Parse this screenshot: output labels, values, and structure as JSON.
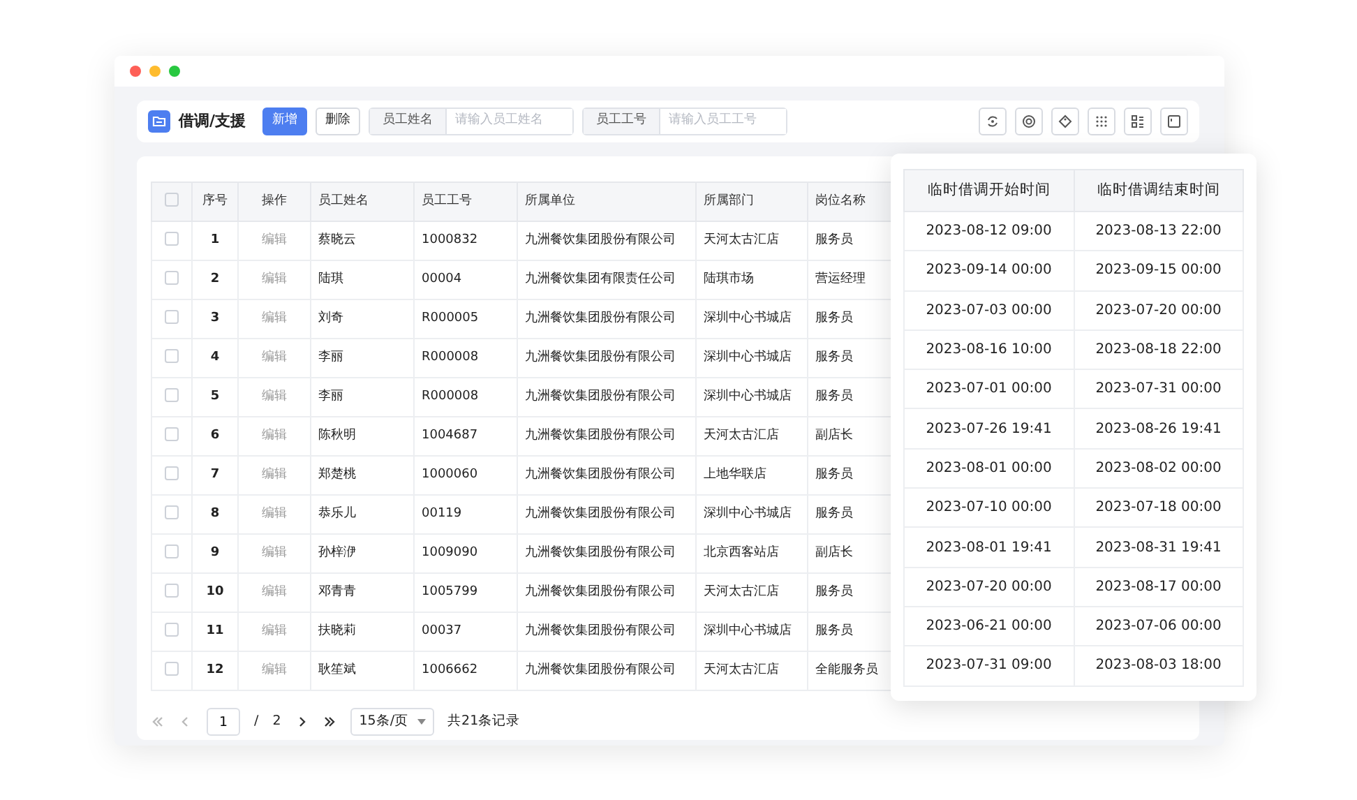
{
  "header": {
    "title": "借调/支援",
    "buttons": [
      {
        "label": "新增",
        "kind": "primary"
      },
      {
        "label": "删除",
        "kind": "default"
      }
    ],
    "filters": [
      {
        "label": "员工姓名",
        "placeholder": "请输入员工姓名"
      },
      {
        "label": "员工工号",
        "placeholder": "请输入员工工号"
      }
    ]
  },
  "table": {
    "columns": [
      "序号",
      "操作",
      "员工姓名",
      "员工工号",
      "所属单位",
      "所属部门",
      "岗位名称"
    ],
    "header_checked": false,
    "rows": [
      {
        "checked": false,
        "cells": [
          "1",
          "编辑",
          "蔡晓云",
          "1000832",
          "九洲餐饮集团股份有限公司",
          "天河太古汇店",
          "服务员"
        ]
      },
      {
        "checked": false,
        "cells": [
          "2",
          "编辑",
          "陆琪",
          "00004",
          "九洲餐饮集团有限责任公司",
          "陆琪市场",
          "营运经理"
        ]
      },
      {
        "checked": false,
        "cells": [
          "3",
          "编辑",
          "刘奇",
          "R000005",
          "九洲餐饮集团股份有限公司",
          "深圳中心书城店",
          "服务员"
        ]
      },
      {
        "checked": false,
        "cells": [
          "4",
          "编辑",
          "李丽",
          "R000008",
          "九洲餐饮集团股份有限公司",
          "深圳中心书城店",
          "服务员"
        ]
      },
      {
        "checked": false,
        "cells": [
          "5",
          "编辑",
          "李丽",
          "R000008",
          "九洲餐饮集团股份有限公司",
          "深圳中心书城店",
          "服务员"
        ]
      },
      {
        "checked": false,
        "cells": [
          "6",
          "编辑",
          "陈秋明",
          "1004687",
          "九洲餐饮集团股份有限公司",
          "天河太古汇店",
          "副店长"
        ]
      },
      {
        "checked": false,
        "cells": [
          "7",
          "编辑",
          "郑楚桃",
          "1000060",
          "九洲餐饮集团股份有限公司",
          "上地华联店",
          "服务员"
        ]
      },
      {
        "checked": false,
        "cells": [
          "8",
          "编辑",
          "恭乐儿",
          "00119",
          "九洲餐饮集团股份有限公司",
          "深圳中心书城店",
          "服务员"
        ]
      },
      {
        "checked": false,
        "cells": [
          "9",
          "编辑",
          "孙梓洢",
          "1009090",
          "九洲餐饮集团股份有限公司",
          "北京西客站店",
          "副店长"
        ]
      },
      {
        "checked": false,
        "cells": [
          "10",
          "编辑",
          "邓青青",
          "1005799",
          "九洲餐饮集团股份有限公司",
          "天河太古汇店",
          "服务员"
        ]
      },
      {
        "checked": false,
        "cells": [
          "11",
          "编辑",
          "扶晓莉",
          "00037",
          "九洲餐饮集团股份有限公司",
          "深圳中心书城店",
          "服务员"
        ]
      },
      {
        "checked": false,
        "cells": [
          "12",
          "编辑",
          "耿笙斌",
          "1006662",
          "九洲餐饮集团股份有限公司",
          "天河太古汇店",
          "全能服务员"
        ]
      }
    ]
  },
  "pagination": {
    "first_disabled": true,
    "prev_disabled": true,
    "page": "1",
    "separator": "/",
    "total_pages": "2",
    "page_size": "15条/页",
    "summary": "共21条记录"
  },
  "popup_table": {
    "columns": [
      "临时借调开始时间",
      "临时借调结束时间"
    ],
    "rows": [
      [
        "2023-08-12 09:00",
        "2023-08-13 22:00"
      ],
      [
        "2023-09-14 00:00",
        "2023-09-15 00:00"
      ],
      [
        "2023-07-03 00:00",
        "2023-07-20 00:00"
      ],
      [
        "2023-08-16 10:00",
        "2023-08-18 22:00"
      ],
      [
        "2023-07-01 00:00",
        "2023-07-31 00:00"
      ],
      [
        "2023-07-26 19:41",
        "2023-08-26 19:41"
      ],
      [
        "2023-08-01 00:00",
        "2023-08-02 00:00"
      ],
      [
        "2023-07-10 00:00",
        "2023-07-18 00:00"
      ],
      [
        "2023-08-01 19:41",
        "2023-08-31 19:41"
      ],
      [
        "2023-07-20 00:00",
        "2023-08-17 00:00"
      ],
      [
        "2023-06-21 00:00",
        "2023-07-06 00:00"
      ],
      [
        "2023-07-31 09:00",
        "2023-08-03 18:00"
      ]
    ]
  }
}
